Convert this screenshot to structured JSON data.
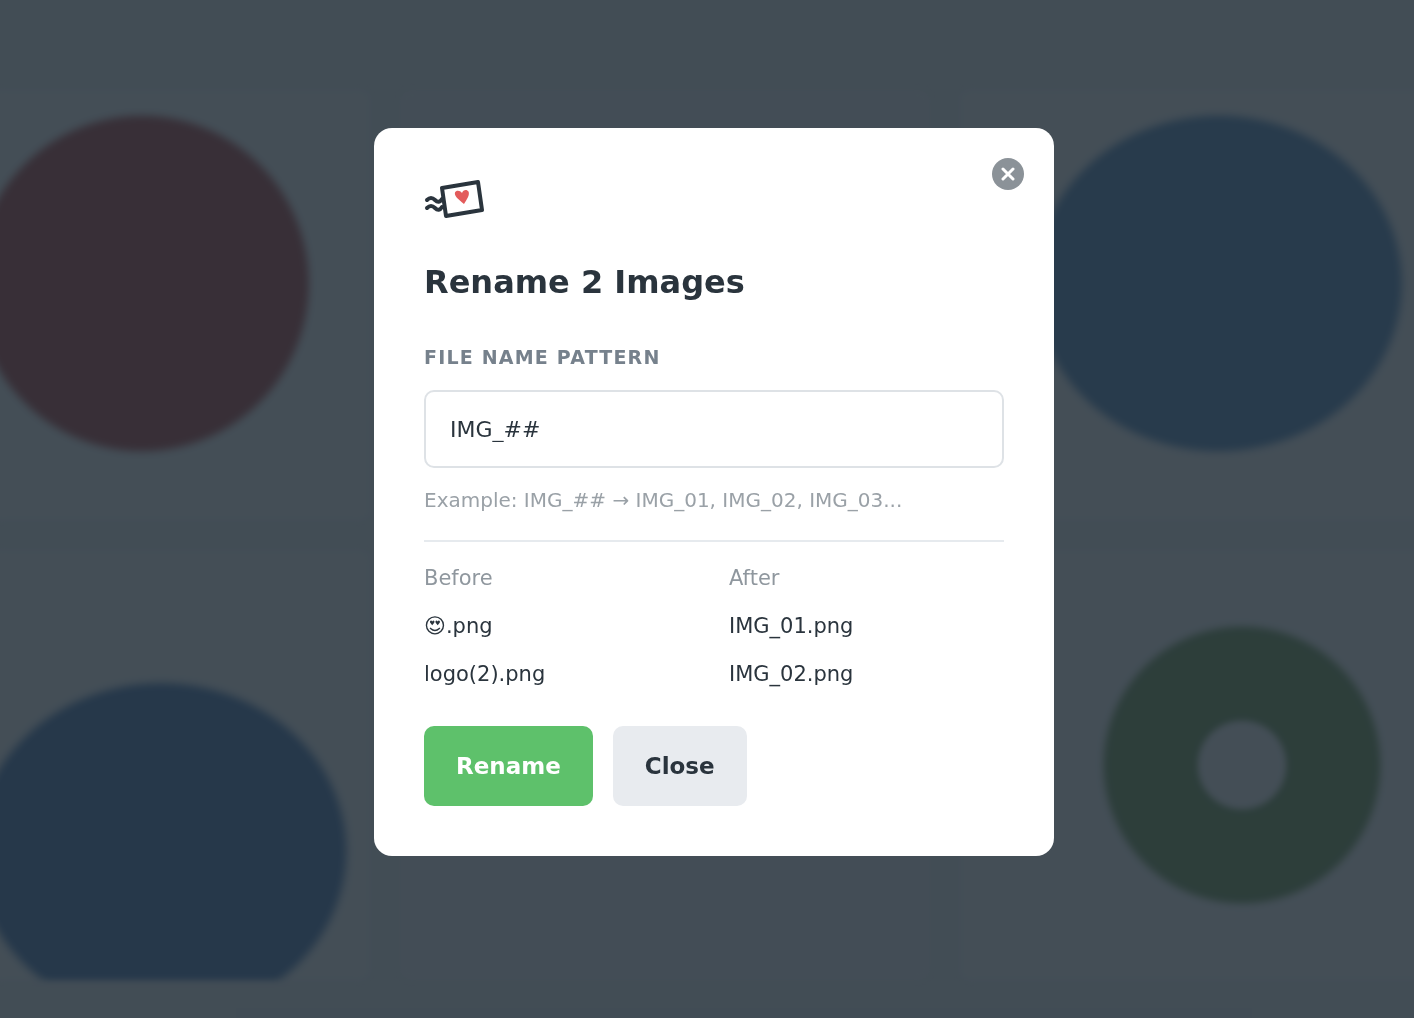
{
  "dialog": {
    "title": "Rename 2 Images",
    "field_label": "FILE NAME PATTERN",
    "pattern": {
      "value": "IMG_##"
    },
    "example": "Example: IMG_## → IMG_01, IMG_02, IMG_03...",
    "columns": [
      "Before",
      "After"
    ],
    "rows": [
      {
        "before": "😍.png",
        "after": "IMG_01.png"
      },
      {
        "before": "logo(2).png",
        "after": "IMG_02.png"
      }
    ],
    "buttons": [
      {
        "label": "Rename",
        "kind": "primary"
      },
      {
        "label": "Close",
        "kind": "secondary"
      }
    ]
  }
}
